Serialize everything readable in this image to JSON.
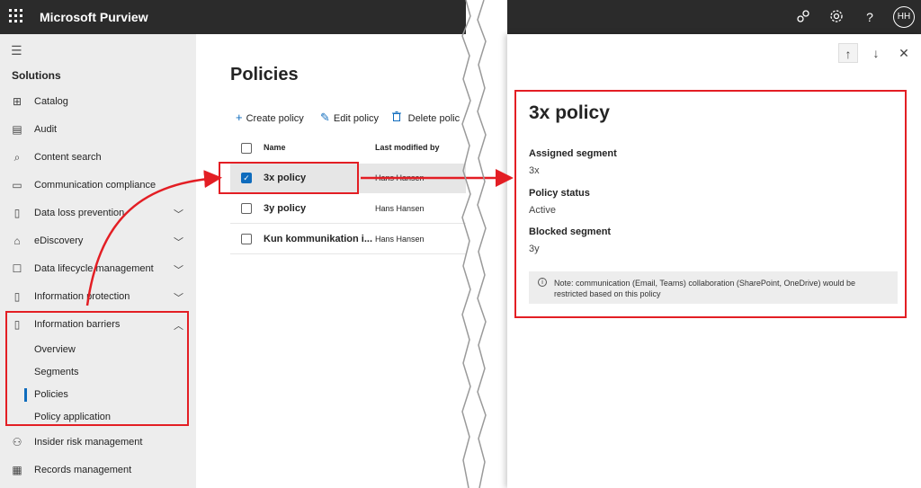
{
  "topbar": {
    "app_title": "Microsoft Purview",
    "icons": [
      "waffle-icon",
      "people-icon",
      "gear-icon",
      "help-icon"
    ],
    "help_glyph": "?",
    "avatar_initials": "HH"
  },
  "sidebar": {
    "section_title": "Solutions",
    "items": [
      {
        "label": "Catalog",
        "icon": "catalog-icon",
        "glyph": "⊞"
      },
      {
        "label": "Audit",
        "icon": "audit-icon",
        "glyph": "▤"
      },
      {
        "label": "Content search",
        "icon": "search-icon",
        "glyph": "⌕"
      },
      {
        "label": "Communication compliance",
        "icon": "chat-icon",
        "glyph": "▭"
      },
      {
        "label": "Data loss prevention",
        "icon": "dlp-icon",
        "glyph": "▯",
        "chevron": "﹀"
      },
      {
        "label": "eDiscovery",
        "icon": "ediscovery-icon",
        "glyph": "⌂",
        "chevron": "﹀"
      },
      {
        "label": "Data lifecycle management",
        "icon": "lifecycle-icon",
        "glyph": "☐",
        "chevron": "﹀"
      },
      {
        "label": "Information protection",
        "icon": "protection-icon",
        "glyph": "▯",
        "chevron": "﹀"
      },
      {
        "label": "Information barriers",
        "icon": "barriers-icon",
        "glyph": "▯",
        "chevron": "︿"
      }
    ],
    "sub_items": [
      "Overview",
      "Segments",
      "Policies",
      "Policy application"
    ],
    "active_sub": "Policies",
    "bottom_items": [
      {
        "label": "Insider risk management",
        "icon": "insider-risk-icon",
        "glyph": "⚇"
      },
      {
        "label": "Records management",
        "icon": "records-icon",
        "glyph": "▦"
      }
    ]
  },
  "main": {
    "title": "Policies",
    "commands": [
      {
        "label": "Create policy",
        "icon": "plus-icon",
        "glyph": "+"
      },
      {
        "label": "Edit policy",
        "icon": "pencil-icon",
        "glyph": "✎"
      },
      {
        "label": "Delete polic",
        "icon": "trash-icon",
        "glyph": "🗑"
      }
    ],
    "columns": {
      "name": "Name",
      "modified": "Last modified by"
    },
    "rows": [
      {
        "name": "3x policy",
        "modified": "Hans Hansen",
        "selected": true
      },
      {
        "name": "3y policy",
        "modified": "Hans Hansen",
        "selected": false
      },
      {
        "name": "Kun kommunikation i...",
        "modified": "Hans Hansen",
        "selected": false
      }
    ]
  },
  "panel": {
    "title": "3x policy",
    "nav": {
      "up": "↑",
      "down": "↓",
      "close": "✕"
    },
    "fields": [
      {
        "label": "Assigned segment",
        "value": "3x"
      },
      {
        "label": "Policy status",
        "value": "Active"
      },
      {
        "label": "Blocked segment",
        "value": "3y"
      }
    ],
    "note_icon": "i",
    "note": "Note: communication (Email, Teams) collaboration (SharePoint, OneDrive) would be restricted based on this policy"
  },
  "colors": {
    "accent": "#0f6cbd",
    "annotation": "#e31e24",
    "topbar": "#2b2b2b",
    "sidebar": "#ededed"
  }
}
